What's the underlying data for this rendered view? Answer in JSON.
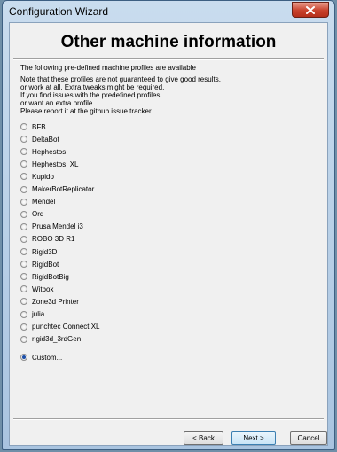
{
  "window": {
    "title": "Configuration Wizard"
  },
  "page": {
    "heading": "Other machine information",
    "intro": "The following pre-defined machine profiles are available",
    "notes": [
      "Note that these profiles are not guaranteed to give good results,",
      "or work at all. Extra tweaks might be required.",
      "If you find issues with the predefined profiles,",
      "or want an extra profile.",
      "Please report it at the github issue tracker."
    ],
    "profiles": [
      "BFB",
      "DeltaBot",
      "Hephestos",
      "Hephestos_XL",
      "Kupido",
      "MakerBotReplicator",
      "Mendel",
      "Ord",
      "Prusa Mendel i3",
      "ROBO 3D R1",
      "Rigid3D",
      "RigidBot",
      "RigidBotBig",
      "Witbox",
      "Zone3d Printer",
      "julia",
      "punchtec Connect XL",
      "rigid3d_3rdGen"
    ],
    "custom": {
      "label": "Custom...",
      "selected": true
    }
  },
  "buttons": {
    "back": "< Back",
    "next": "Next >",
    "cancel": "Cancel"
  },
  "colors": {
    "accent": "#1c4fa8",
    "close_button": "#c8412b"
  }
}
